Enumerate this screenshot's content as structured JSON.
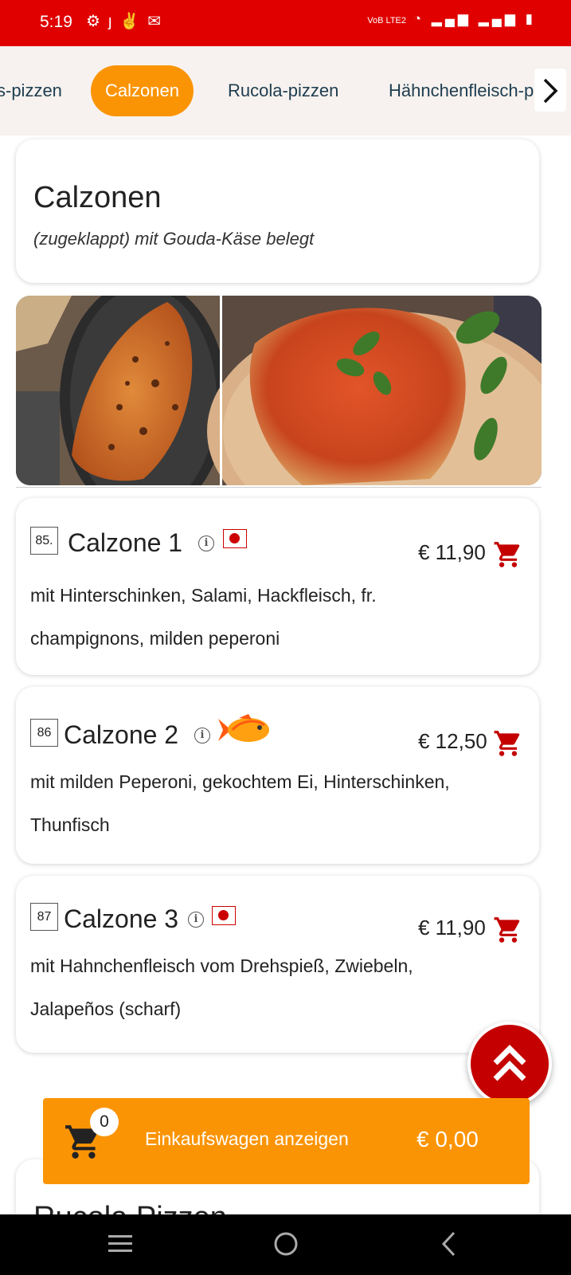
{
  "status_bar": {
    "time": "5:19",
    "notification_icons": [
      "settings-icon",
      "j-icon",
      "runner-icon",
      "gmail-icon"
    ],
    "network": "VoB LTE2",
    "right_icons": [
      "wifi-icon",
      "signal-icon",
      "signal-icon",
      "battery-icon"
    ]
  },
  "tabs": [
    {
      "label": "s-pizzen",
      "active": false
    },
    {
      "label": "Calzonen",
      "active": true
    },
    {
      "label": "Rucola-pizzen",
      "active": false
    },
    {
      "label": "Hähnchenfleisch-p",
      "active": false
    }
  ],
  "category": {
    "title": "Calzonen",
    "description": "(zugeklappt) mit Gouda-Käse belegt"
  },
  "products": [
    {
      "number": "85.",
      "name": "Calzone 1",
      "badge": "flag-icon",
      "price": "€ 11,90",
      "desc_line1": "mit Hinterschinken, Salami, Hackfleisch, fr.",
      "desc_line2": "champignons, milden peperoni"
    },
    {
      "number": "86",
      "name": "Calzone 2",
      "badge": "fish-icon",
      "price": "€ 12,50",
      "desc_line1": "mit milden Peperoni, gekochtem Ei, Hinterschinken,",
      "desc_line2": "Thunfisch"
    },
    {
      "number": "87",
      "name": "Calzone 3",
      "badge": "flag-icon",
      "price": "€ 11,90",
      "desc_line1": "mit Hahnchenfleisch vom Drehspieß, Zwiebeln,",
      "desc_line2": "Jalapeños (scharf)"
    }
  ],
  "cart": {
    "count": "0",
    "label": "Einkaufswagen anzeigen",
    "total": "€ 0,00"
  },
  "next_category": {
    "title": "Rucola Pizzen"
  },
  "colors": {
    "status_bar": "#e00000",
    "accent": "#fb9404",
    "cart_icon": "#c40000",
    "tabbar_bg": "#f7f2ef"
  }
}
